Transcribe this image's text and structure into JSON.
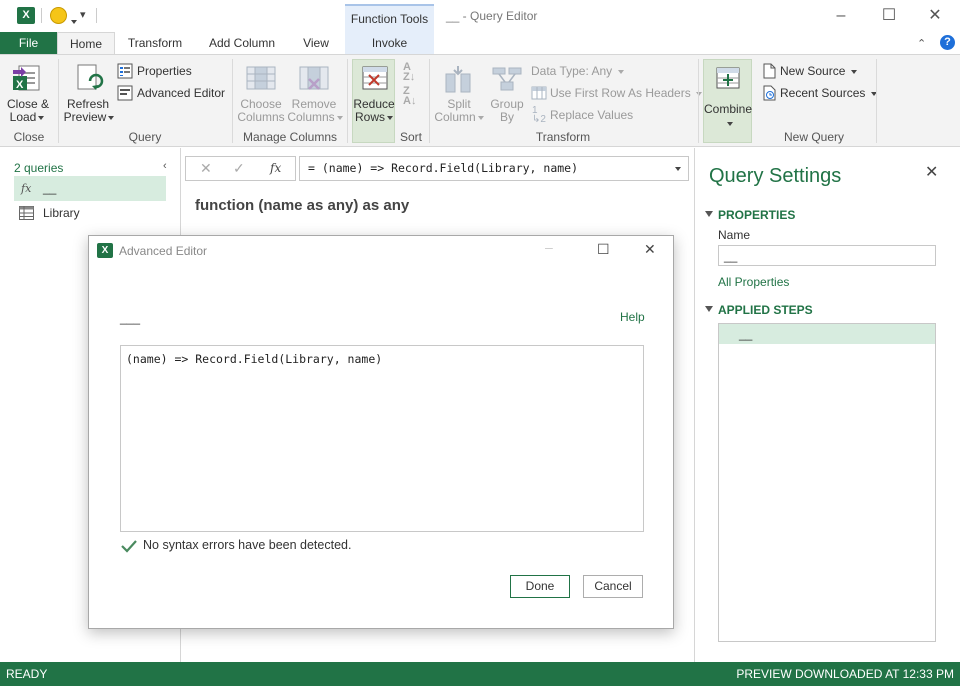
{
  "titlebar": {
    "context_group": "Function Tools",
    "window_title": "__ - Query Editor"
  },
  "tabs": {
    "file": "File",
    "home": "Home",
    "transform": "Transform",
    "add_column": "Add Column",
    "view": "View",
    "invoke": "Invoke"
  },
  "ribbon": {
    "close_group": {
      "label": "Close",
      "close_load": "Close &",
      "close_load_2": "Load"
    },
    "query_group": {
      "label": "Query",
      "refresh": "Refresh",
      "refresh_2": "Preview",
      "properties": "Properties",
      "advanced_editor": "Advanced Editor"
    },
    "manage_columns_group": {
      "label": "Manage Columns",
      "choose": "Choose",
      "choose_2": "Columns",
      "remove": "Remove",
      "remove_2": "Columns"
    },
    "sort_group": {
      "label": "Sort",
      "reduce": "Reduce",
      "reduce_2": "Rows"
    },
    "transform_group": {
      "label": "Transform",
      "split": "Split",
      "split_2": "Column",
      "group_by": "Group",
      "group_by_2": "By",
      "data_type": "Data Type: Any",
      "first_row": "Use First Row As Headers",
      "replace": "Replace Values"
    },
    "combine": "Combine",
    "new_query_group": {
      "label": "New Query",
      "new_source": "New Source",
      "recent_sources": "Recent Sources"
    }
  },
  "left_pane": {
    "count": "2 queries",
    "items": [
      {
        "icon": "fx-icon",
        "label": "__"
      },
      {
        "icon": "table-icon",
        "label": "Library"
      }
    ]
  },
  "formula_bar": {
    "formula": "= (name) => Record.Field(Library, name)"
  },
  "main": {
    "signature": "function (name as any) as any"
  },
  "query_settings": {
    "title": "Query Settings",
    "properties_header": "PROPERTIES",
    "name_label": "Name",
    "name_value": "__",
    "all_properties": "All Properties",
    "applied_steps_header": "APPLIED STEPS",
    "steps": [
      "__"
    ]
  },
  "status": {
    "left": "READY",
    "right": "PREVIEW DOWNLOADED AT 12:33 PM"
  },
  "dialog": {
    "title": "Advanced Editor",
    "query_name": "___",
    "help": "Help",
    "code": "(name) => Record.Field(Library, name)",
    "syntax_status": "No syntax errors have been detected.",
    "done": "Done",
    "cancel": "Cancel"
  },
  "colors": {
    "accent": "#217346",
    "selection": "#d7ecdf",
    "context_tab": "#e5eefa"
  }
}
